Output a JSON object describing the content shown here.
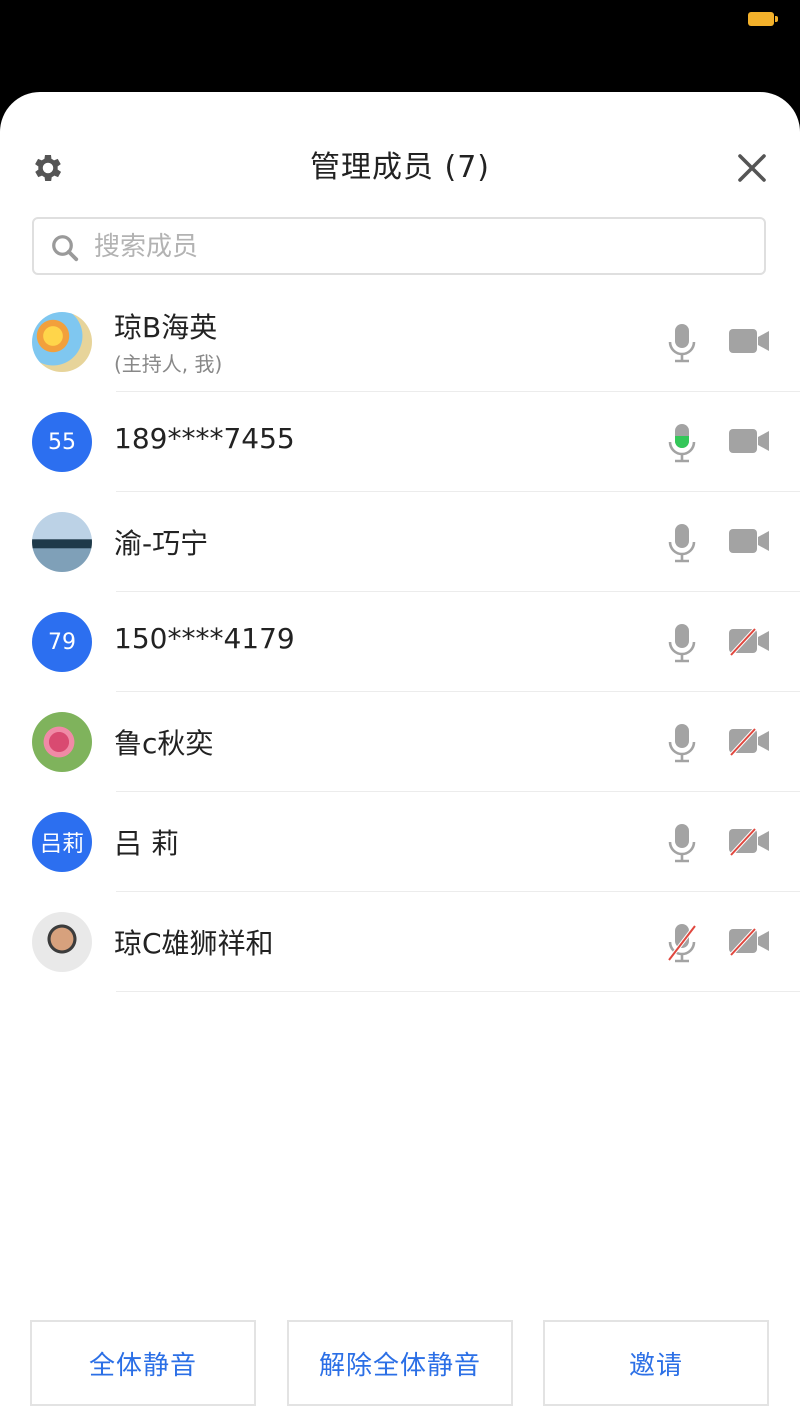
{
  "status_bar": {
    "battery_color": "#f3b12b"
  },
  "panel": {
    "title": "管理成员 (7)"
  },
  "search": {
    "placeholder": "搜索成员",
    "value": ""
  },
  "members": [
    {
      "name": "琼B海英",
      "subtitle": "(主持人, 我)",
      "avatar": {
        "type": "photo"
      },
      "mic": "on",
      "camera": "on"
    },
    {
      "name": "189****7455",
      "avatar": {
        "type": "initials",
        "text": "55"
      },
      "mic": "speaking",
      "camera": "on"
    },
    {
      "name": "渝-巧宁",
      "avatar": {
        "type": "photo"
      },
      "mic": "on",
      "camera": "on"
    },
    {
      "name": "150****4179",
      "avatar": {
        "type": "initials",
        "text": "79"
      },
      "mic": "on",
      "camera": "off"
    },
    {
      "name": "鲁c秋奕",
      "avatar": {
        "type": "photo"
      },
      "mic": "on",
      "camera": "off"
    },
    {
      "name": "吕 莉",
      "avatar": {
        "type": "initials",
        "text": "吕莉"
      },
      "mic": "on",
      "camera": "off"
    },
    {
      "name": "琼C雄狮祥和",
      "avatar": {
        "type": "photo"
      },
      "mic": "off",
      "camera": "off"
    }
  ],
  "actions": {
    "mute_all": "全体静音",
    "unmute_all": "解除全体静音",
    "invite": "邀请"
  },
  "colors": {
    "accent": "#2b6fe6",
    "avatar_blue": "#2c6ff0",
    "speaking": "#34c759",
    "off": "#e0473e",
    "icon_gray": "#9b9b9b"
  }
}
